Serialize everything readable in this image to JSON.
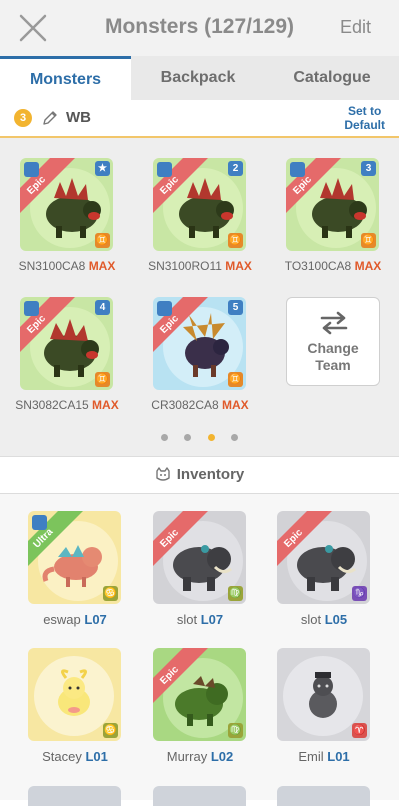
{
  "header": {
    "title": "Monsters (127/129)",
    "edit_label": "Edit"
  },
  "tabs": [
    {
      "label": "Monsters",
      "active": true
    },
    {
      "label": "Backpack",
      "active": false
    },
    {
      "label": "Catalogue",
      "active": false
    }
  ],
  "team": {
    "number": "3",
    "name": "WB",
    "set_default_line1": "Set to",
    "set_default_line2": "Default"
  },
  "team_slots": [
    {
      "name": "SN3100CA8",
      "level": "MAX",
      "rarity": "Epic",
      "corner": "★",
      "element": "orange",
      "bg": "green"
    },
    {
      "name": "SN3100RO11",
      "level": "MAX",
      "rarity": "Epic",
      "corner": "2",
      "element": "orange",
      "bg": "green"
    },
    {
      "name": "TO3100CA8",
      "level": "MAX",
      "rarity": "Epic",
      "corner": "3",
      "element": "orange",
      "bg": "green"
    },
    {
      "name": "SN3082CA15",
      "level": "MAX",
      "rarity": "Epic",
      "corner": "4",
      "element": "orange",
      "bg": "green"
    },
    {
      "name": "CR3082CA8",
      "level": "MAX",
      "rarity": "Epic",
      "corner": "5",
      "element": "orange",
      "bg": "blue"
    }
  ],
  "change_team": {
    "line1": "Change",
    "line2": "Team"
  },
  "pager": {
    "count": 4,
    "active_index": 2
  },
  "inventory": {
    "title": "Inventory",
    "items": [
      {
        "name": "eswap",
        "level": "L07",
        "rarity": "Ultra",
        "bg": "yellow",
        "element": "olive"
      },
      {
        "name": "slot",
        "level": "L07",
        "rarity": "Epic",
        "bg": "grey",
        "element": "olive"
      },
      {
        "name": "slot",
        "level": "L05",
        "rarity": "Epic",
        "bg": "grey",
        "element": "purple"
      },
      {
        "name": "Stacey",
        "level": "L01",
        "rarity": "",
        "bg": "yellow",
        "element": "olive"
      },
      {
        "name": "Murray",
        "level": "L02",
        "rarity": "Epic",
        "bg": "green",
        "element": "olive"
      },
      {
        "name": "Emil",
        "level": "L01",
        "rarity": "",
        "bg": "grey",
        "element": "red"
      }
    ]
  },
  "colors": {
    "accent": "#2d6ea8",
    "max": "#e05a2b",
    "epic_ribbon": "#e56a6a",
    "ultra_ribbon": "#7cc45c",
    "gold": "#f2b430"
  }
}
